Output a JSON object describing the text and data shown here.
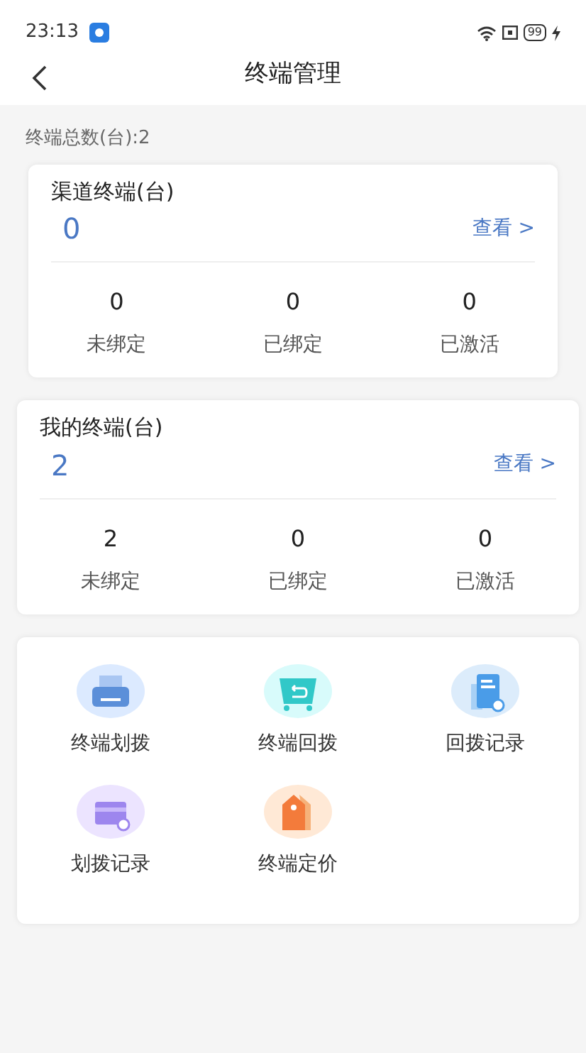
{
  "status_bar": {
    "time": "23:13",
    "battery": "99"
  },
  "header": {
    "title": "终端管理"
  },
  "summary": "终端总数(台):2",
  "cards": [
    {
      "title": "渠道终端(台)",
      "total": "0",
      "link": "查看",
      "link_icon": ">",
      "narrow": true,
      "stats": [
        {
          "value": "0",
          "label": "未绑定"
        },
        {
          "value": "0",
          "label": "已绑定"
        },
        {
          "value": "0",
          "label": "已激活"
        }
      ]
    },
    {
      "title": "我的终端(台)",
      "total": "2",
      "link": "查看",
      "link_icon": ">",
      "narrow": false,
      "stats": [
        {
          "value": "2",
          "label": "未绑定"
        },
        {
          "value": "0",
          "label": "已绑定"
        },
        {
          "value": "0",
          "label": "已激活"
        }
      ]
    }
  ],
  "menu": [
    {
      "kind": "tray",
      "label": "终端划拨"
    },
    {
      "kind": "return",
      "label": "终端回拨"
    },
    {
      "kind": "docsearch",
      "label": "回拨记录"
    },
    {
      "kind": "cardsearch",
      "label": "划拨记录"
    },
    {
      "kind": "tag",
      "label": "终端定价"
    }
  ]
}
